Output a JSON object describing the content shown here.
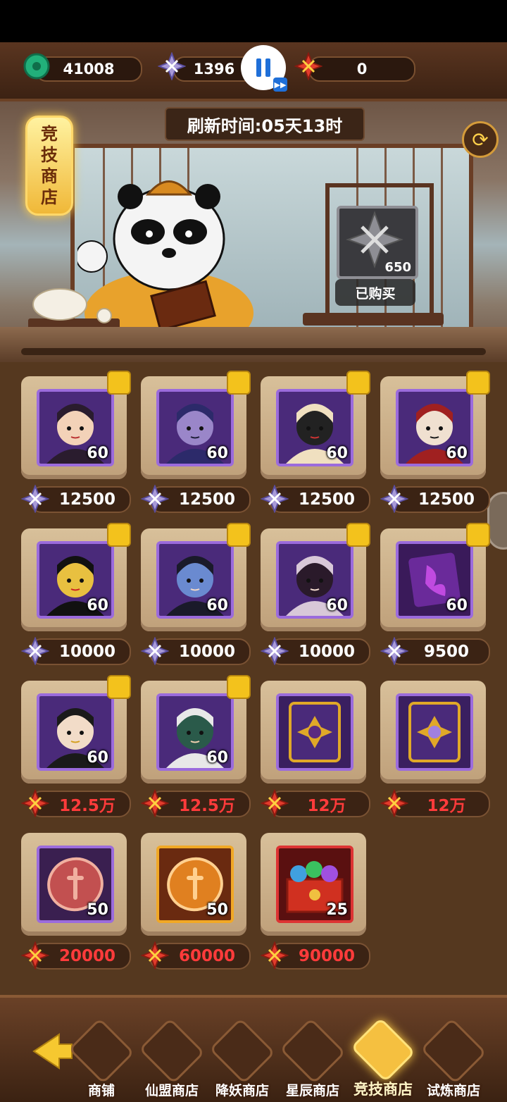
{
  "currencies": [
    {
      "name": "jade",
      "value": "41008",
      "color": "#22b07a"
    },
    {
      "name": "crystal-star",
      "value": "1396",
      "color": "#a89ad8"
    },
    {
      "name": "red-swords",
      "value": "0",
      "color": "#e23c2c"
    }
  ],
  "banner": {
    "refresh_text": "刷新时间:05天13时",
    "shop_sign": [
      "竞",
      "技",
      "商",
      "店"
    ],
    "gong_price": "650",
    "bought_label": "已购买"
  },
  "items": [
    {
      "level": "60",
      "price": "12500",
      "currency": "crystal",
      "kind": "hero",
      "palette": [
        "#2a1c2e",
        "#f3d2b8",
        "#b33"
      ]
    },
    {
      "level": "60",
      "price": "12500",
      "currency": "crystal",
      "kind": "hero",
      "palette": [
        "#2c2a6a",
        "#9a86c9",
        "#1f1f3a"
      ]
    },
    {
      "level": "60",
      "price": "12500",
      "currency": "crystal",
      "kind": "hero",
      "palette": [
        "#f0e0c0",
        "#222",
        "#c33"
      ]
    },
    {
      "level": "60",
      "price": "12500",
      "currency": "crystal",
      "kind": "hero",
      "palette": [
        "#a02020",
        "#f0e0d0",
        "#1b1b1b"
      ]
    },
    {
      "level": "60",
      "price": "10000",
      "currency": "crystal",
      "kind": "hero",
      "palette": [
        "#111",
        "#e8c040",
        "#c22"
      ]
    },
    {
      "level": "60",
      "price": "10000",
      "currency": "crystal",
      "kind": "hero",
      "palette": [
        "#1a1a2a",
        "#6a8ad0",
        "#f2d8c8"
      ]
    },
    {
      "level": "60",
      "price": "10000",
      "currency": "crystal",
      "kind": "hero",
      "palette": [
        "#d8c8d8",
        "#2a1a2a",
        "#f4dcd0"
      ]
    },
    {
      "level": "60",
      "price": "9500",
      "currency": "crystal",
      "kind": "fragment",
      "palette": [
        "#3a1a5a",
        "#c04ae0",
        "#6a2a9a"
      ]
    },
    {
      "level": "60",
      "price": "12.5万",
      "currency": "swords",
      "kind": "hero",
      "palette": [
        "#1a1a1a",
        "#f2dcc8",
        "#d4a020"
      ]
    },
    {
      "level": "60",
      "price": "12.5万",
      "currency": "swords",
      "kind": "hero",
      "palette": [
        "#e8e8e8",
        "#2a5a4a",
        "#f2d0b0"
      ]
    },
    {
      "level": "",
      "price": "12万",
      "currency": "swords",
      "kind": "card",
      "palette": [
        "#3a1f60",
        "#e0a828",
        "#5a2a80"
      ]
    },
    {
      "level": "",
      "price": "12万",
      "currency": "swords",
      "kind": "card",
      "palette": [
        "#3a1f60",
        "#e0a828",
        "#a080e0"
      ]
    },
    {
      "level": "50",
      "price": "20000",
      "currency": "swords",
      "kind": "coin",
      "palette": [
        "#3a1f50",
        "#c25050",
        "#f0b0a0"
      ],
      "frame": "purple"
    },
    {
      "level": "50",
      "price": "60000",
      "currency": "swords",
      "kind": "coin",
      "palette": [
        "#6a2a10",
        "#e08020",
        "#ffd090"
      ],
      "frame": "gold"
    },
    {
      "level": "25",
      "price": "90000",
      "currency": "swords",
      "kind": "chest",
      "palette": [
        "#5a1010",
        "#d03020",
        "#40a0e0"
      ],
      "frame": "red"
    }
  ],
  "nav": [
    {
      "label": "商铺",
      "icon": "panda-icon",
      "active": false
    },
    {
      "label": "仙盟商店",
      "icon": "banner-icon",
      "active": false
    },
    {
      "label": "降妖商店",
      "icon": "red-envelope-icon",
      "active": false
    },
    {
      "label": "星辰商店",
      "icon": "pagoda-icon",
      "active": false
    },
    {
      "label": "竞技商店",
      "icon": "arena-icon",
      "active": true
    },
    {
      "label": "试炼商店",
      "icon": "trial-icon",
      "active": false
    }
  ]
}
